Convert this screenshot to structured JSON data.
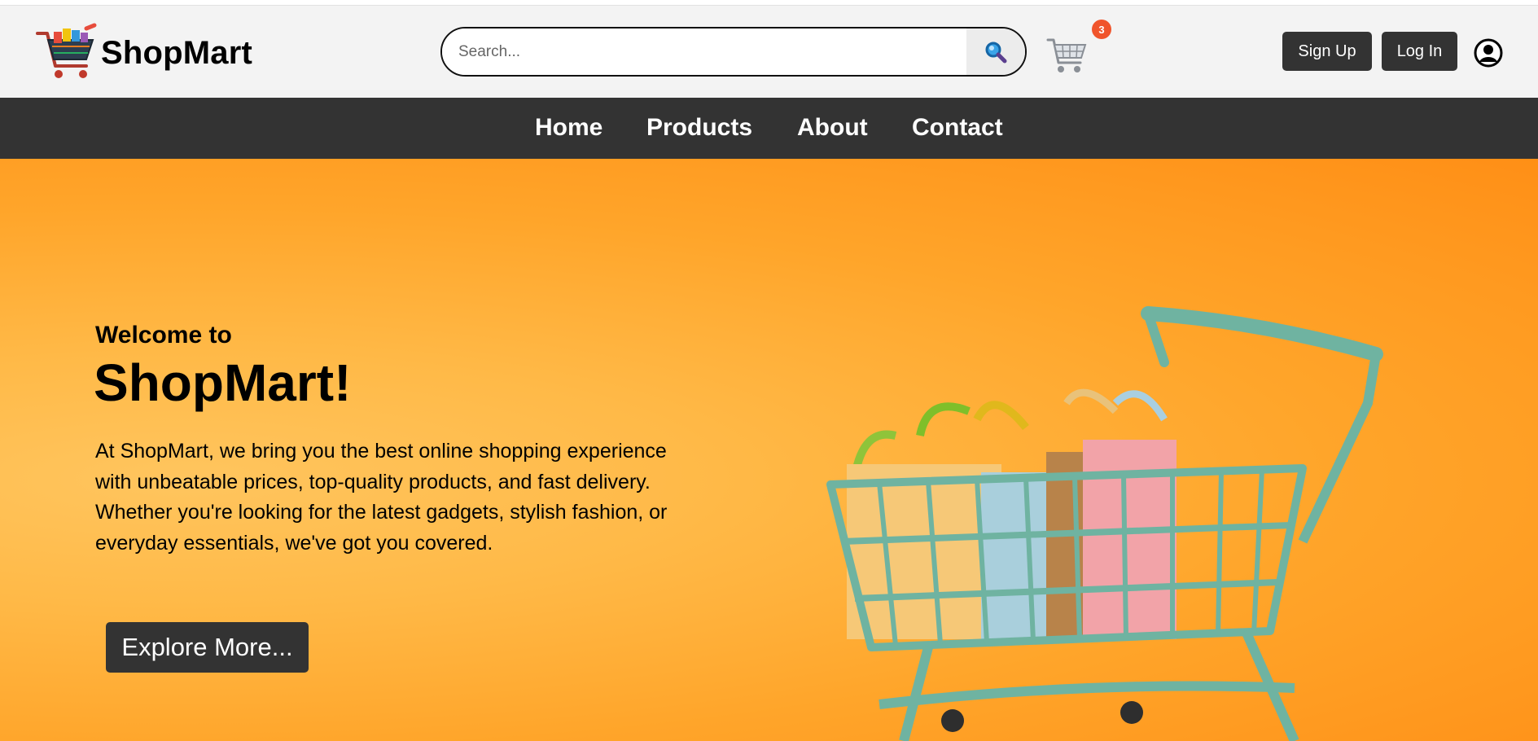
{
  "header": {
    "brand": "ShopMart",
    "search": {
      "placeholder": "Search...",
      "value": ""
    },
    "cart_count": "3",
    "signup_label": "Sign Up",
    "login_label": "Log In"
  },
  "nav": {
    "items": [
      "Home",
      "Products",
      "About",
      "Contact"
    ]
  },
  "hero": {
    "welcome": "Welcome to",
    "brand": "ShopMart!",
    "description": "At ShopMart, we bring you the best online shopping experience with unbeatable prices, top-quality products, and fast delivery. Whether you're looking for the latest gadgets, stylish fashion, or everyday essentials, we've got you covered.",
    "cta": "Explore More..."
  },
  "icons": {
    "logo": "shopping-cart-logo-icon",
    "search": "magnifier-icon",
    "cart": "shopping-cart-icon",
    "user": "user-circle-icon"
  },
  "colors": {
    "header_bg": "#f3f3f3",
    "nav_bg": "#333333",
    "button_bg": "#333333",
    "badge": "#f0542b",
    "hero_orange": "#ffa52a",
    "cart_teal": "#76b9a6"
  }
}
